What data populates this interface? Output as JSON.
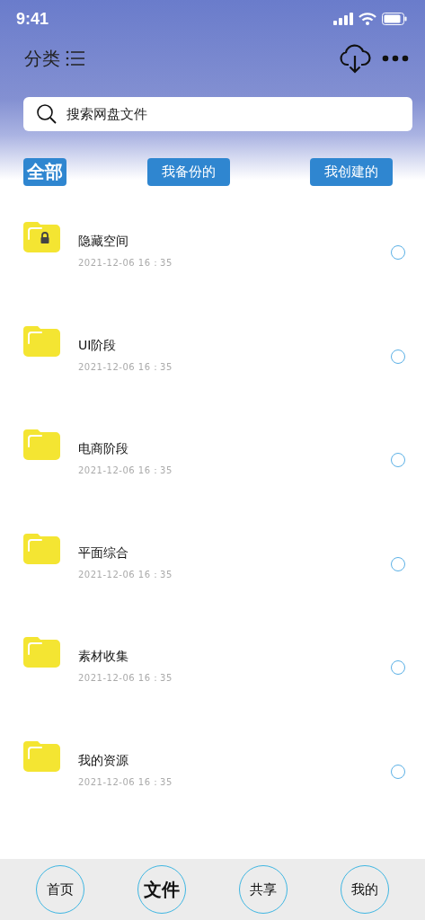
{
  "status_bar": {
    "time": "9:41"
  },
  "header": {
    "title": "分类"
  },
  "search": {
    "placeholder": "搜索网盘文件"
  },
  "filters": [
    {
      "label": "全部",
      "selected": true
    },
    {
      "label": "我备份的",
      "selected": false
    },
    {
      "label": "我创建的",
      "selected": false
    }
  ],
  "folders": [
    {
      "name": "隐藏空间",
      "date": "2021-12-06 16：35",
      "locked": true,
      "selected": false
    },
    {
      "name": "UI阶段",
      "date": "2021-12-06 16：35",
      "locked": false,
      "selected": false
    },
    {
      "name": "电商阶段",
      "date": "2021-12-06 16：35",
      "locked": false,
      "selected": false
    },
    {
      "name": "平面综合",
      "date": "2021-12-06 16：35",
      "locked": false,
      "selected": false
    },
    {
      "name": "素材收集",
      "date": "2021-12-06 16：35",
      "locked": false,
      "selected": false
    },
    {
      "name": "我的资源",
      "date": "2021-12-06 16：35",
      "locked": false,
      "selected": false
    }
  ],
  "tab_bar": [
    {
      "label": "首页",
      "selected": false
    },
    {
      "label": "文件",
      "selected": true
    },
    {
      "label": "共享",
      "selected": false
    },
    {
      "label": "我的",
      "selected": false
    }
  ]
}
